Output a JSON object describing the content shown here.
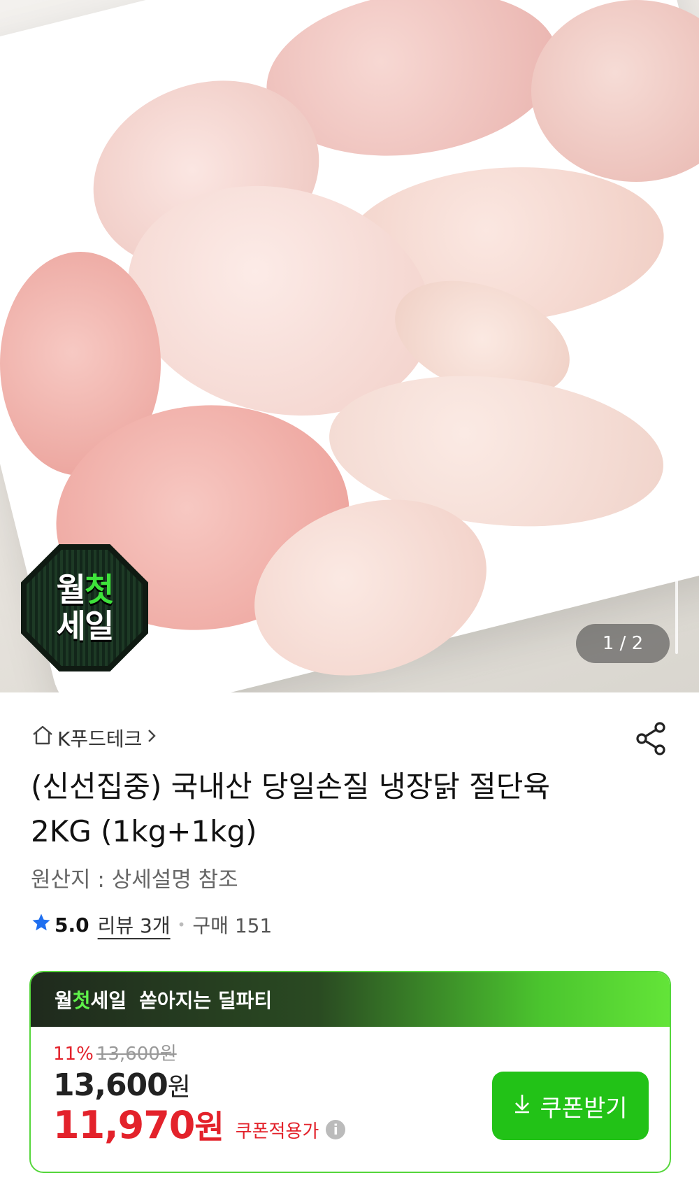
{
  "gallery": {
    "badge_line1_a": "월",
    "badge_line1_b": "첫",
    "badge_line2": "세일",
    "counter": "1 / 2"
  },
  "product": {
    "seller": "K푸드테크",
    "title": "(신선집중) 국내산 당일손질 냉장닭 절단육 2KG (1kg+1kg)",
    "origin": "원산지 : 상세설명 참조",
    "rating": "5.0",
    "review": "리뷰 3개",
    "purchase": "구매 151"
  },
  "deal": {
    "head_a": "월",
    "head_b": "첫",
    "head_c": "세일",
    "head_d": "쏟아지는 딜파티",
    "discount_pct": "11%",
    "original_price": "13,600원",
    "price_num": "13,600",
    "price_unit": "원",
    "final_num": "11,970",
    "final_unit": "원",
    "coupon_note": "쿠폰적용가",
    "coupon_button": "쿠폰받기"
  },
  "colors": {
    "accent_green": "#22c217",
    "sale_red": "#e3222b"
  }
}
